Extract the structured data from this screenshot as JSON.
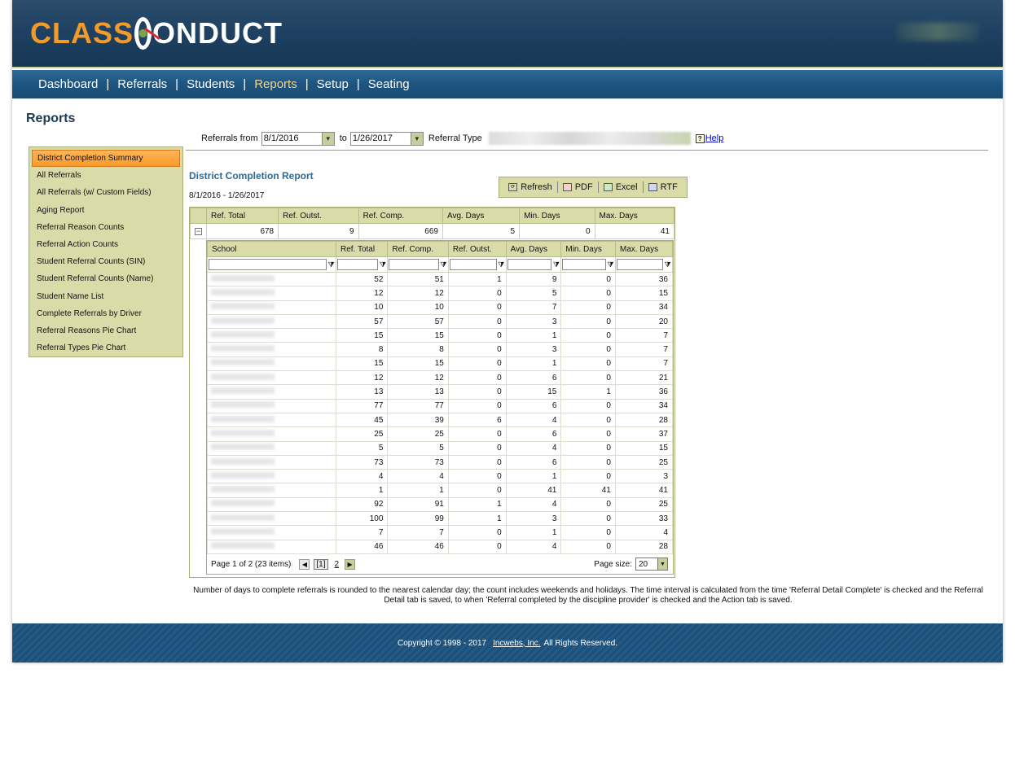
{
  "app": {
    "logo": {
      "word1": "CLASS",
      "word2": "ONDUCT"
    }
  },
  "nav": [
    {
      "label": "Dashboard",
      "active": false
    },
    {
      "label": "Referrals",
      "active": false
    },
    {
      "label": "Students",
      "active": false
    },
    {
      "label": "Reports",
      "active": true
    },
    {
      "label": "Setup",
      "active": false
    },
    {
      "label": "Seating",
      "active": false
    }
  ],
  "page": {
    "title": "Reports"
  },
  "filters": {
    "from_label": "Referrals from",
    "from_value": "8/1/2016",
    "to_label": "to",
    "to_value": "1/26/2017",
    "type_label": "Referral Type",
    "help_label": "Help"
  },
  "sidebar": {
    "items": [
      {
        "label": "District Completion Summary",
        "active": true
      },
      {
        "label": "All Referrals"
      },
      {
        "label": "All Referrals (w/ Custom Fields)"
      },
      {
        "label": "Aging Report"
      },
      {
        "label": "Referral Reason Counts"
      },
      {
        "label": "Referral Action Counts"
      },
      {
        "label": "Student Referral Counts (SIN)"
      },
      {
        "label": "Student Referral Counts (Name)"
      },
      {
        "label": "Student Name List"
      },
      {
        "label": "Complete Referrals by Driver"
      },
      {
        "label": "Referral Reasons Pie Chart"
      },
      {
        "label": "Referral Types Pie Chart"
      }
    ]
  },
  "report": {
    "title": "District Completion Report",
    "range": "8/1/2016 - 1/26/2017",
    "toolbar": {
      "refresh": "Refresh",
      "pdf": "PDF",
      "excel": "Excel",
      "rtf": "RTF"
    },
    "summary": {
      "headers": [
        "Ref. Total",
        "Ref. Outst.",
        "Ref. Comp.",
        "Avg. Days",
        "Min. Days",
        "Max. Days"
      ],
      "values": [
        "678",
        "9",
        "669",
        "5",
        "0",
        "41"
      ]
    },
    "detail": {
      "headers": [
        "School",
        "Ref. Total",
        "Ref. Comp.",
        "Ref. Outst.",
        "Avg. Days",
        "Min. Days",
        "Max. Days"
      ],
      "rows": [
        [
          "52",
          "51",
          "1",
          "9",
          "0",
          "36"
        ],
        [
          "12",
          "12",
          "0",
          "5",
          "0",
          "15"
        ],
        [
          "10",
          "10",
          "0",
          "7",
          "0",
          "34"
        ],
        [
          "57",
          "57",
          "0",
          "3",
          "0",
          "20"
        ],
        [
          "15",
          "15",
          "0",
          "1",
          "0",
          "7"
        ],
        [
          "8",
          "8",
          "0",
          "3",
          "0",
          "7"
        ],
        [
          "15",
          "15",
          "0",
          "1",
          "0",
          "7"
        ],
        [
          "12",
          "12",
          "0",
          "6",
          "0",
          "21"
        ],
        [
          "13",
          "13",
          "0",
          "15",
          "1",
          "36"
        ],
        [
          "77",
          "77",
          "0",
          "6",
          "0",
          "34"
        ],
        [
          "45",
          "39",
          "6",
          "4",
          "0",
          "28"
        ],
        [
          "25",
          "25",
          "0",
          "6",
          "0",
          "37"
        ],
        [
          "5",
          "5",
          "0",
          "4",
          "0",
          "15"
        ],
        [
          "73",
          "73",
          "0",
          "6",
          "0",
          "25"
        ],
        [
          "4",
          "4",
          "0",
          "1",
          "0",
          "3"
        ],
        [
          "1",
          "1",
          "0",
          "41",
          "41",
          "41"
        ],
        [
          "92",
          "91",
          "1",
          "4",
          "0",
          "25"
        ],
        [
          "100",
          "99",
          "1",
          "3",
          "0",
          "33"
        ],
        [
          "7",
          "7",
          "0",
          "1",
          "0",
          "4"
        ],
        [
          "46",
          "46",
          "0",
          "4",
          "0",
          "28"
        ]
      ]
    },
    "pager": {
      "info": "Page 1 of 2 (23 items)",
      "current": "[1]",
      "next_page": "2",
      "page_size_label": "Page size:",
      "page_size_value": "20"
    },
    "note": "Number of days to complete referrals is rounded to the nearest calendar day; the count includes weekends and holidays. The time interval is calculated from the time 'Referral Detail Complete' is checked and the Referral Detail tab is saved, to when 'Referral completed by the discipline provider' is checked and the Action tab is saved."
  },
  "footer": {
    "copyright": "Copyright © 1998 - 2017",
    "company": "Incwebs, Inc.",
    "rights": "All Rights Reserved."
  },
  "colors": {
    "header_bg": "#1f4263",
    "nav_bg": "#1d5580",
    "accent_orange": "#f89a2a",
    "panel_bg": "#d9dca9",
    "link_blue": "#0000cc"
  }
}
